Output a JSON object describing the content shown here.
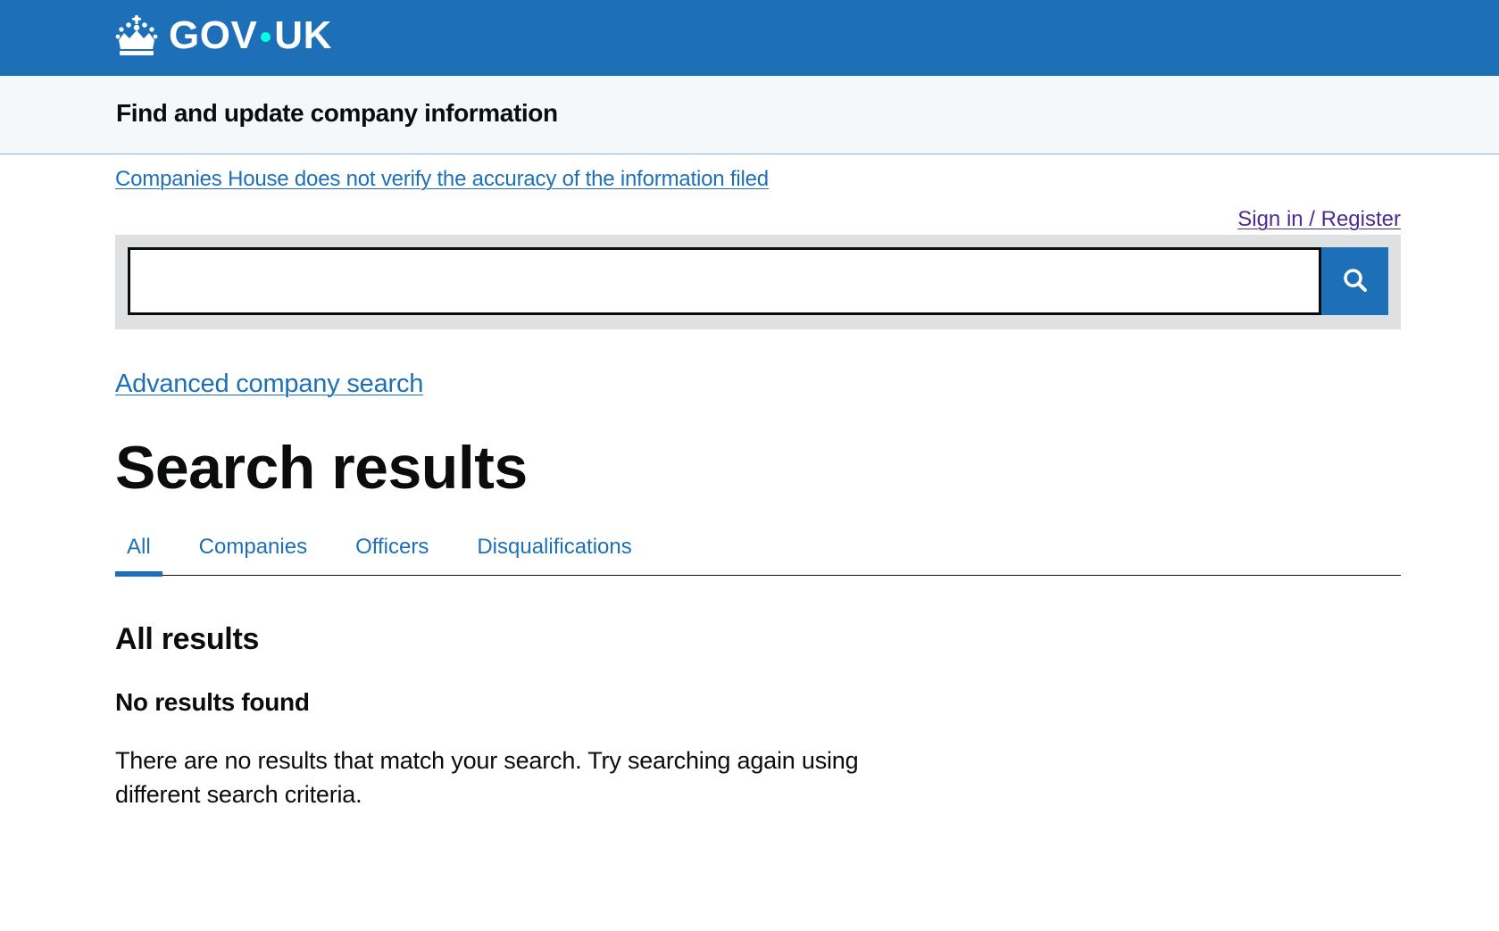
{
  "header": {
    "logo_text_left": "GOV",
    "logo_text_right": "UK",
    "logo_icon": "crown-icon",
    "brand_color": "#1d70b8",
    "dot_color": "#00ffe0"
  },
  "service": {
    "name": "Find and update company information"
  },
  "disclaimer": {
    "text": "Companies House does not verify the accuracy of the information filed"
  },
  "account": {
    "signin_label": "Sign in / Register"
  },
  "search": {
    "value": "",
    "button_icon": "search-icon"
  },
  "advanced_search": {
    "label": "Advanced company search"
  },
  "page": {
    "title": "Search results"
  },
  "tabs": [
    {
      "label": "All",
      "active": true
    },
    {
      "label": "Companies",
      "active": false
    },
    {
      "label": "Officers",
      "active": false
    },
    {
      "label": "Disqualifications",
      "active": false
    }
  ],
  "results": {
    "heading": "All results",
    "empty_title": "No results found",
    "empty_message": "There are no results that match your search. Try searching again using different search criteria."
  }
}
